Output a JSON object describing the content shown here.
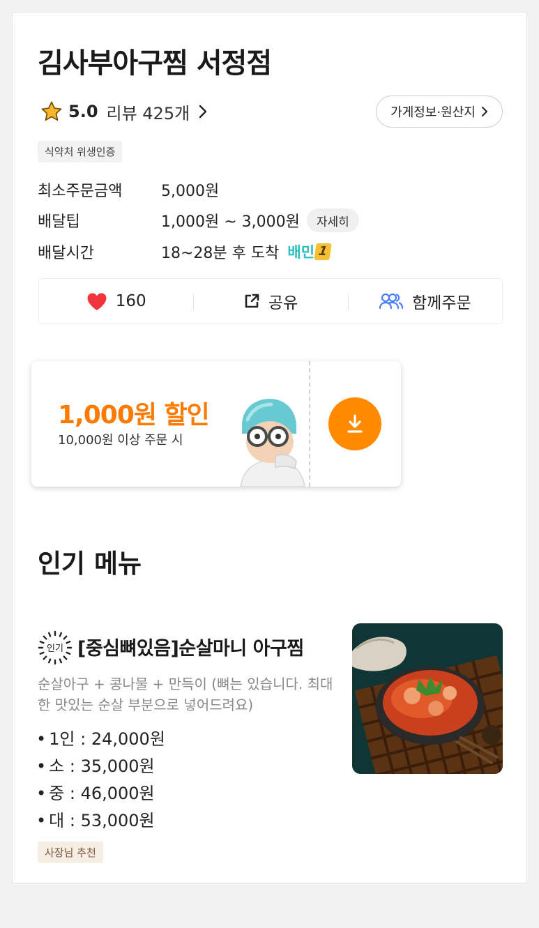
{
  "store": {
    "name": "김사부아구찜 서정점",
    "rating": "5.0",
    "review_text": "리뷰 425개",
    "info_button": "가게정보·원산지",
    "cert_tag": "식약처 위생인증"
  },
  "info": {
    "min_order_label": "최소주문금액",
    "min_order_value": "5,000원",
    "tip_label": "배달팁",
    "tip_value": "1,000원 ~ 3,000원",
    "tip_detail": "자세히",
    "time_label": "배달시간",
    "time_value": "18~28분 후 도착",
    "baemin_text": "배민",
    "baemin_num": "1"
  },
  "actions": {
    "like_count": "160",
    "share_label": "공유",
    "group_order_label": "함께주문"
  },
  "coupon": {
    "amount": "1,000원 할인",
    "condition": "10,000원 이상 주문 시"
  },
  "popular": {
    "section_title": "인기 메뉴",
    "badge_text": "인기",
    "menu_name": "[중심뼈있음]순살마니 아구찜",
    "description": "순살아구 + 콩나물 + 만득이 (뼈는 있습니다. 최대한 맛있는 순살 부분으로 넣어드려요)",
    "prices": [
      "1인 : 24,000원",
      "소 : 35,000원",
      "중 : 46,000원",
      "대 : 53,000원"
    ],
    "owner_tag": "사장님 추천"
  },
  "colors": {
    "accent_orange": "#ff7a00",
    "baemin_mint": "#2ac1bc",
    "heart_red": "#f0353c",
    "group_blue": "#4a7cff"
  },
  "icons": {
    "rating": "star-icon",
    "like": "heart-icon",
    "share": "share-icon",
    "group": "people-icon",
    "download": "download-icon"
  }
}
